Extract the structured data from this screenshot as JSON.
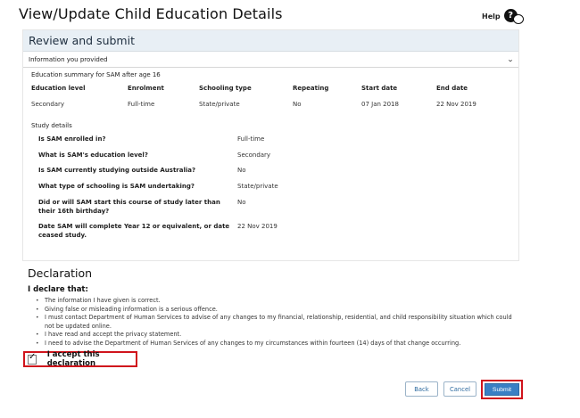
{
  "page": {
    "title": "View/Update Child Education Details",
    "help_label": "Help",
    "help_icon": "question-mark-icon"
  },
  "panel": {
    "heading": "Review and submit",
    "accordion_label": "Information you provided",
    "summary_title": "Education summary for SAM after age 16",
    "columns": [
      "Education level",
      "Enrolment",
      "Schooling type",
      "Repeating",
      "Start date",
      "End date"
    ],
    "row": [
      "Secondary",
      "Full-time",
      "State/private",
      "No",
      "07 Jan 2018",
      "22 Nov 2019"
    ],
    "study_title": "Study details",
    "questions": [
      {
        "q": "Is SAM enrolled in?",
        "a": "Full-time"
      },
      {
        "q": "What is SAM's education level?",
        "a": "Secondary"
      },
      {
        "q": "Is SAM currently studying outside Australia?",
        "a": "No"
      },
      {
        "q": "What type of schooling is SAM undertaking?",
        "a": "State/private"
      },
      {
        "q": "Did or will SAM start this course of study later than their 16th birthday?",
        "a": "No"
      },
      {
        "q": "Date SAM will complete Year 12 or equivalent, or date ceased study.",
        "a": "22 Nov 2019"
      }
    ]
  },
  "declaration": {
    "title": "Declaration",
    "subtitle": "I declare that:",
    "items": [
      "The information I have given is correct.",
      "Giving false or misleading information is a serious offence.",
      "I must contact Department of Human Services to advise of any changes to my financial, relationship, residential, and child responsibility situation which could not be updated online.",
      "I have read and accept the privacy statement.",
      "I need to advise the Department of Human Services of any changes to my circumstances within fourteen (14) days of that change occurring."
    ],
    "accept_label": "I accept this declaration",
    "accept_checked": true
  },
  "buttons": {
    "back": "Back",
    "cancel": "Cancel",
    "submit": "Submit"
  },
  "colors": {
    "highlight": "#d0141c",
    "primary": "#3a7fc4",
    "panel_header": "#e8eff5"
  }
}
